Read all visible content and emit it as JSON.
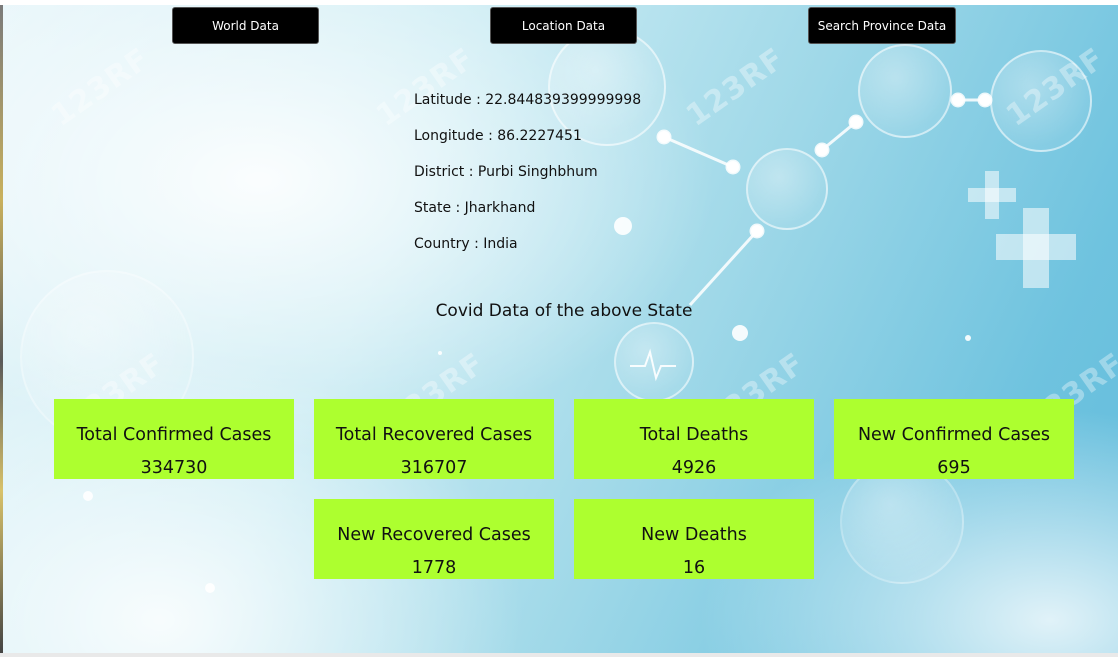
{
  "nav": {
    "world_label": "World Data",
    "location_label": "Location Data",
    "province_label": "Search Province Data"
  },
  "location": {
    "latitude": "Latitude : 22.844839399999998",
    "longitude": "Longitude : 86.2227451",
    "district": "District : Purbi Singhbhum",
    "state": "State : Jharkhand",
    "country": "Country : India"
  },
  "covid": {
    "heading": "Covid Data of the above State",
    "cards": [
      {
        "title": "Total Confirmed Cases",
        "value": "334730"
      },
      {
        "title": "Total Recovered Cases",
        "value": "316707"
      },
      {
        "title": "Total Deaths",
        "value": "4926"
      },
      {
        "title": "New Confirmed Cases",
        "value": "695"
      },
      {
        "title": "New Recovered Cases",
        "value": "1778"
      },
      {
        "title": "New Deaths",
        "value": "16"
      }
    ]
  },
  "background": {
    "watermark_text": "123RF"
  },
  "colors": {
    "card_bg": "#adff2f",
    "button_bg": "#000000",
    "button_text": "#ffffff"
  }
}
